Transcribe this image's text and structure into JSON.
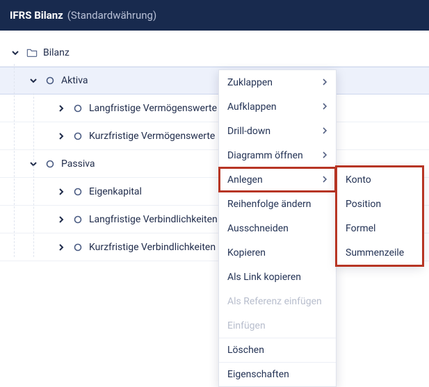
{
  "topbar": {
    "title": "IFRS Bilanz",
    "subtitle": "(Standardwährung)"
  },
  "tree": {
    "root": {
      "label": "Bilanz"
    },
    "aktiva": {
      "label": "Aktiva",
      "children": [
        {
          "label": "Langfristige Vermögenswerte"
        },
        {
          "label": "Kurzfristige Vermögenswerte"
        }
      ]
    },
    "passiva": {
      "label": "Passiva",
      "children": [
        {
          "label": "Eigenkapital"
        },
        {
          "label": "Langfristige Verbindlichkeiten"
        },
        {
          "label": "Kurzfristige Verbindlichkeiten"
        }
      ]
    }
  },
  "context_menu": {
    "items": [
      {
        "label": "Zuklappen",
        "submenu": true
      },
      {
        "label": "Aufklappen",
        "submenu": true
      },
      {
        "label": "Drill-down",
        "submenu": true
      },
      {
        "label": "Diagramm öffnen",
        "submenu": true
      },
      {
        "label": "Anlegen",
        "submenu": true,
        "highlighted": true
      },
      {
        "label": "Reihenfolge ändern"
      },
      {
        "label": "Ausschneiden"
      },
      {
        "label": "Kopieren"
      },
      {
        "label": "Als Link kopieren"
      },
      {
        "label": "Als Referenz einfügen",
        "disabled": true
      },
      {
        "label": "Einfügen",
        "disabled": true
      },
      {
        "label": "Löschen",
        "sep_before": true
      },
      {
        "label": "Eigenschaften",
        "sep_before": true
      }
    ]
  },
  "submenu_anlegen": {
    "items": [
      {
        "label": "Konto"
      },
      {
        "label": "Position"
      },
      {
        "label": "Formel"
      },
      {
        "label": "Summenzeile"
      }
    ]
  }
}
